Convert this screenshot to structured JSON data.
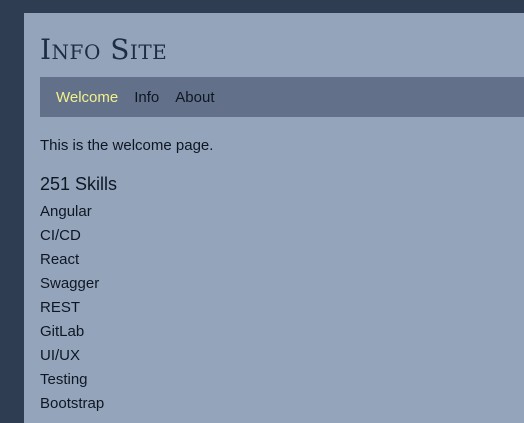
{
  "site": {
    "title": "Info Site"
  },
  "nav": {
    "items": [
      {
        "label": "Welcome",
        "active": true
      },
      {
        "label": "Info",
        "active": false
      },
      {
        "label": "About",
        "active": false
      }
    ]
  },
  "main": {
    "intro": "This is the welcome page.",
    "skills_heading": "251 Skills",
    "skills": [
      "Angular",
      "CI/CD",
      "React",
      "Swagger",
      "REST",
      "GitLab",
      "UI/UX",
      "Testing",
      "Bootstrap"
    ]
  },
  "colors": {
    "page_background": "#2e3d52",
    "panel_background": "#94a5bb",
    "navbar_background": "#627189",
    "active_nav": "#f3f08a",
    "text": "#0e1624"
  }
}
